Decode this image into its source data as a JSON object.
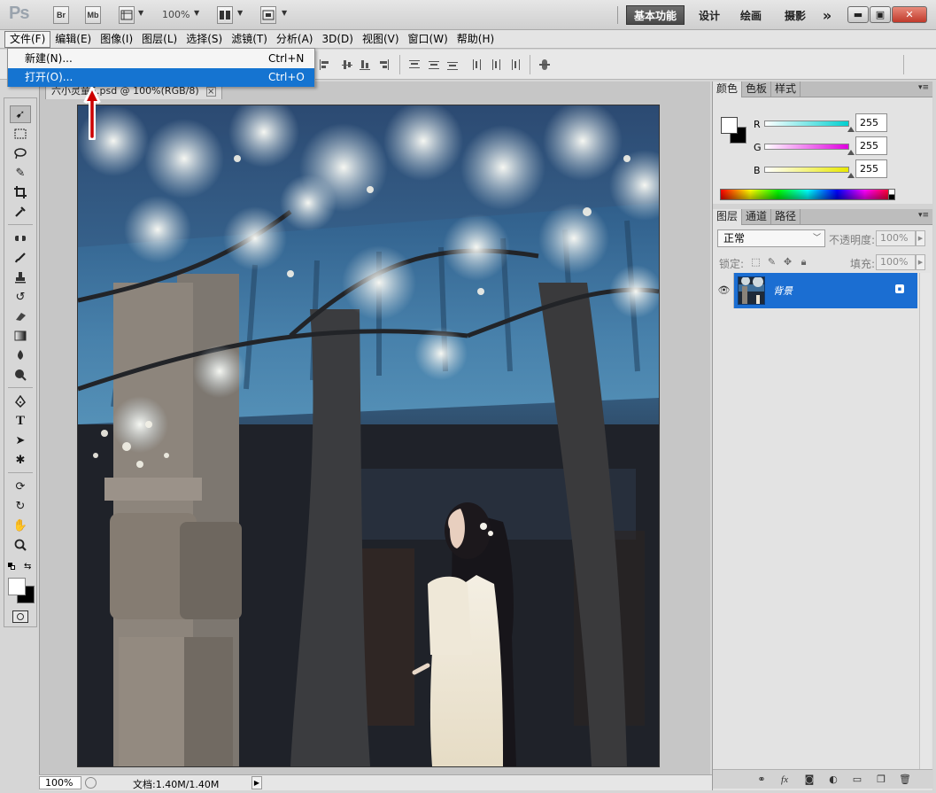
{
  "app": {
    "logo": "Ps",
    "bridge_btn": "Br",
    "minibridge_btn": "Mb",
    "zoom_level": "100%",
    "workspaces": [
      "基本功能",
      "设计",
      "绘画",
      "摄影"
    ],
    "more_btn": "»"
  },
  "menubar": {
    "items": [
      "文件(F)",
      "编辑(E)",
      "图像(I)",
      "图层(L)",
      "选择(S)",
      "滤镜(T)",
      "分析(A)",
      "3D(D)",
      "视图(V)",
      "窗口(W)",
      "帮助(H)"
    ]
  },
  "file_menu": {
    "items": [
      {
        "label": "新建(N)...",
        "shortcut": "Ctrl+N"
      },
      {
        "label": "打开(O)...",
        "shortcut": "Ctrl+O"
      }
    ]
  },
  "document": {
    "tab_title": "六小灵童5.psd @ 100%(RGB/8)",
    "close_glyph": "×"
  },
  "statusbar": {
    "zoom": "100%",
    "doc_info": "文档:1.40M/1.40M"
  },
  "color_panel": {
    "tabs": [
      "颜色",
      "色板",
      "样式"
    ],
    "channels": [
      {
        "label": "R",
        "value": "255",
        "color": "#00c8c8"
      },
      {
        "label": "G",
        "value": "255",
        "color": "#e000e0"
      },
      {
        "label": "B",
        "value": "255",
        "color": "#e8e800"
      }
    ]
  },
  "layers_panel": {
    "tabs": [
      "图层",
      "通道",
      "路径"
    ],
    "blend_mode": "正常",
    "opacity_label": "不透明度:",
    "opacity": "100%",
    "lock_label": "锁定:",
    "fill_label": "填充:",
    "fill": "100%",
    "layers": [
      {
        "name": "背景"
      }
    ]
  },
  "colors": {
    "selection_blue": "#1574d1",
    "layer_highlight": "#1b6ed2",
    "annotation_red": "#cc0000"
  }
}
